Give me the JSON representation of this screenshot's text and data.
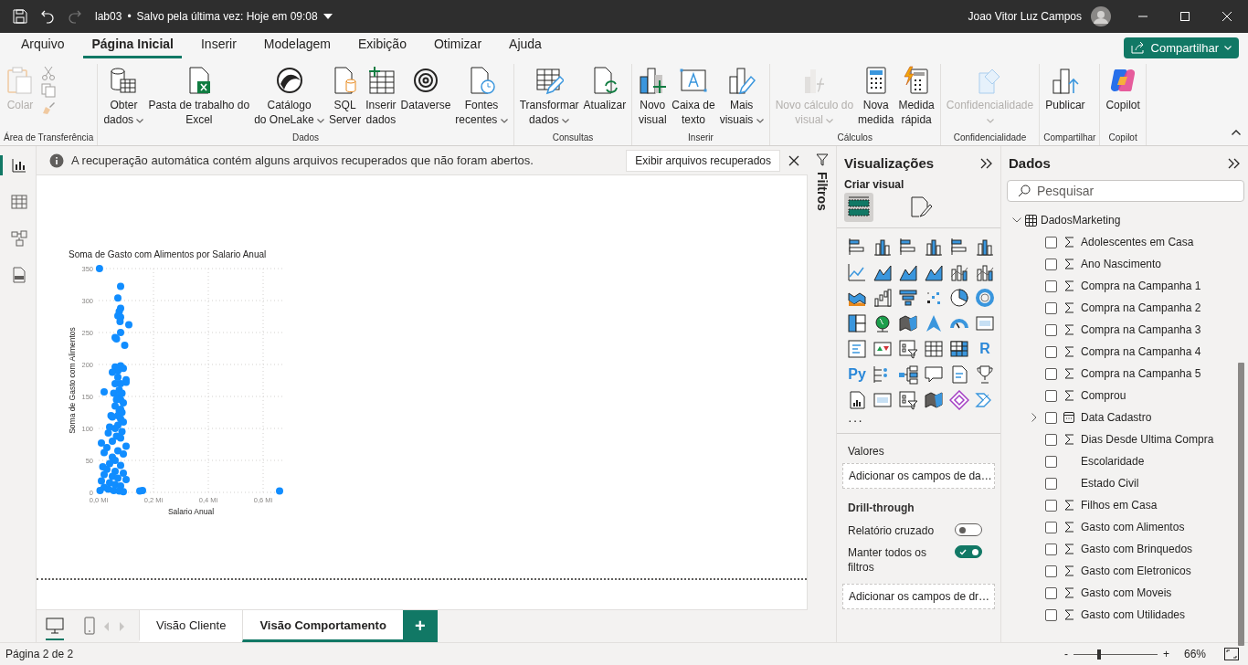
{
  "title_bar": {
    "file": "lab03",
    "separator": "•",
    "save_status": "Salvo pela última vez: Hoje em 09:08",
    "user": "Joao Vitor Luz Campos"
  },
  "menu_tabs": [
    {
      "label": "Arquivo",
      "selected": false
    },
    {
      "label": "Página Inicial",
      "selected": true
    },
    {
      "label": "Inserir",
      "selected": false
    },
    {
      "label": "Modelagem",
      "selected": false
    },
    {
      "label": "Exibição",
      "selected": false
    },
    {
      "label": "Otimizar",
      "selected": false
    },
    {
      "label": "Ajuda",
      "selected": false
    }
  ],
  "share_button": "Compartilhar",
  "ribbon": {
    "groups": [
      {
        "label": "Área de Transferência",
        "items": [
          {
            "lines": [
              "Colar"
            ],
            "dropdown": false,
            "disabled": true
          }
        ]
      },
      {
        "label": "Dados",
        "items": [
          {
            "lines": [
              "Obter",
              "dados"
            ],
            "dropdown": true,
            "disabled": false
          },
          {
            "lines": [
              "Pasta de trabalho do",
              "Excel"
            ],
            "dropdown": false,
            "disabled": false
          },
          {
            "lines": [
              "Catálogo",
              "do OneLake"
            ],
            "dropdown": true,
            "disabled": false
          },
          {
            "lines": [
              "SQL",
              "Server"
            ],
            "dropdown": false,
            "disabled": false
          },
          {
            "lines": [
              "Inserir",
              "dados"
            ],
            "dropdown": false,
            "disabled": false
          },
          {
            "lines": [
              "Dataverse"
            ],
            "dropdown": false,
            "disabled": false
          },
          {
            "lines": [
              "Fontes",
              "recentes"
            ],
            "dropdown": true,
            "disabled": false
          }
        ]
      },
      {
        "label": "Consultas",
        "items": [
          {
            "lines": [
              "Transformar",
              "dados"
            ],
            "dropdown": true,
            "disabled": false
          },
          {
            "lines": [
              "Atualizar"
            ],
            "dropdown": false,
            "disabled": false
          }
        ]
      },
      {
        "label": "Inserir",
        "items": [
          {
            "lines": [
              "Novo",
              "visual"
            ],
            "dropdown": false,
            "disabled": false
          },
          {
            "lines": [
              "Caixa de",
              "texto"
            ],
            "dropdown": false,
            "disabled": false
          },
          {
            "lines": [
              "Mais",
              "visuais"
            ],
            "dropdown": true,
            "disabled": false
          }
        ]
      },
      {
        "label": "Cálculos",
        "items": [
          {
            "lines": [
              "Novo cálculo do",
              "visual"
            ],
            "dropdown": true,
            "disabled": true
          },
          {
            "lines": [
              "Nova",
              "medida"
            ],
            "dropdown": false,
            "disabled": false
          },
          {
            "lines": [
              "Medida",
              "rápida"
            ],
            "dropdown": false,
            "disabled": false
          }
        ]
      },
      {
        "label": "Confidencialidade",
        "items": [
          {
            "lines": [
              "Confidencialidade"
            ],
            "dropdown": true,
            "disabled": true
          }
        ]
      },
      {
        "label": "Compartilhar",
        "items": [
          {
            "lines": [
              "Publicar"
            ],
            "dropdown": false,
            "disabled": false
          }
        ]
      },
      {
        "label": "Copilot",
        "items": [
          {
            "lines": [
              "Copilot"
            ],
            "dropdown": false,
            "disabled": false
          }
        ]
      }
    ]
  },
  "info_bar": {
    "message": "A recuperação automática contém alguns arquivos recuperados que não foram abertos.",
    "action": "Exibir arquivos recuperados"
  },
  "nav_views": [
    {
      "selected": true
    },
    {
      "selected": false
    },
    {
      "selected": false
    },
    {
      "selected": false
    }
  ],
  "chart": {
    "chart_data": {
      "type": "scatter",
      "title": "Soma de Gasto com Alimentos por Salario Anual",
      "xlabel": "Salario Anual",
      "ylabel": "Soma de Gasto com Alimentos",
      "grid": true,
      "xlim": [
        0,
        0.68
      ],
      "ylim": [
        0,
        350
      ],
      "xticks": [
        {
          "value": 0,
          "label": "0,0 Mi"
        },
        {
          "value": 0.2,
          "label": "0,2 Mi"
        },
        {
          "value": 0.4,
          "label": "0,4 Mi"
        },
        {
          "value": 0.6,
          "label": "0,6 Mi"
        }
      ],
      "yticks": [
        0,
        50,
        100,
        150,
        200,
        250,
        300,
        350
      ],
      "x": [
        0.08,
        0.07,
        0.08,
        0.075,
        0.07,
        0.08,
        0.078,
        0.11,
        0.08,
        0.06,
        0.065,
        0.095,
        0.08,
        0.06,
        0.09,
        0.07,
        0.05,
        0.1,
        0.1,
        0.06,
        0.02,
        0.055,
        0.07,
        0.08,
        0.09,
        0.06,
        0.075,
        0.045,
        0.05,
        0.08,
        0.09,
        0.07,
        0.04,
        0.06,
        0.085,
        0.035,
        0.065,
        0.08,
        0.05,
        0.01,
        0.1,
        0.03,
        0.07,
        0.02,
        0.09,
        0.05,
        0.06,
        0.04,
        0.08,
        0.015,
        0.03,
        0.06,
        0.09,
        0.02,
        0.05,
        0.07,
        0.1,
        0.01,
        0.04,
        0.06,
        0.08,
        0.02,
        0.035,
        0.055,
        0.075,
        0.09,
        0.005,
        0.15,
        0.16,
        0.66,
        0.003,
        0.07,
        0.08,
        0.075,
        0.085,
        0.065,
        0.08,
        0.07,
        0.085
      ],
      "series": [
        {
          "color": "#118dff",
          "values": [
            322,
            304,
            288,
            283,
            276,
            274,
            267,
            262,
            250,
            242,
            240,
            230,
            198,
            196,
            194,
            190,
            188,
            176,
            172,
            170,
            157,
            155,
            150,
            145,
            140,
            135,
            128,
            120,
            118,
            115,
            110,
            105,
            102,
            100,
            95,
            93,
            88,
            85,
            80,
            77,
            72,
            70,
            65,
            62,
            60,
            55,
            50,
            45,
            42,
            40,
            36,
            33,
            30,
            28,
            25,
            22,
            20,
            18,
            15,
            12,
            10,
            8,
            5,
            3,
            2,
            1,
            3,
            2,
            3,
            2,
            350,
            180,
            170,
            160,
            155,
            145,
            130,
            120,
            125
          ]
        }
      ]
    }
  },
  "layout_views": [
    {
      "selected": true
    },
    {
      "selected": false
    }
  ],
  "page_tabs": [
    {
      "label": "Visão Cliente",
      "selected": false
    },
    {
      "label": "Visão Comportamento",
      "selected": true
    }
  ],
  "add_page": "+",
  "filters_pane": {
    "title": "Filtros"
  },
  "visualizations": {
    "title": "Visualizações",
    "section": "Criar visual",
    "tabs": [
      {
        "selected": true
      },
      {
        "selected": false
      }
    ],
    "text_icons": [
      "R",
      "Py"
    ],
    "more": "···",
    "wells": [
      {
        "label": "Valores",
        "placeholder": "Adicionar os campos de da…"
      }
    ],
    "drill_through": {
      "title": "Drill-through",
      "toggles": [
        {
          "label": "Relatório cruzado",
          "on": false
        },
        {
          "label": "Manter todos os filtros",
          "on": true
        }
      ],
      "placeholder": "Adicionar os campos de dr…"
    }
  },
  "data": {
    "title": "Dados",
    "search": {
      "placeholder": "Pesquisar"
    },
    "tables": [
      {
        "name": "DadosMarketing",
        "expanded": true,
        "fields": [
          {
            "name": "Adolescentes em Casa",
            "kind": "measure",
            "checked": false
          },
          {
            "name": "Ano Nascimento",
            "kind": "measure",
            "checked": false
          },
          {
            "name": "Compra na Campanha 1",
            "kind": "measure",
            "checked": false
          },
          {
            "name": "Compra na Campanha 2",
            "kind": "measure",
            "checked": false
          },
          {
            "name": "Compra na Campanha 3",
            "kind": "measure",
            "checked": false
          },
          {
            "name": "Compra na Campanha 4",
            "kind": "measure",
            "checked": false
          },
          {
            "name": "Compra na Campanha 5",
            "kind": "measure",
            "checked": false
          },
          {
            "name": "Comprou",
            "kind": "measure",
            "checked": false
          },
          {
            "name": "Data Cadastro",
            "kind": "date",
            "checked": false
          },
          {
            "name": "Dias Desde Ultima Compra",
            "kind": "measure",
            "checked": false
          },
          {
            "name": "Escolaridade",
            "kind": "text",
            "checked": false
          },
          {
            "name": "Estado Civil",
            "kind": "text",
            "checked": false
          },
          {
            "name": "Filhos em Casa",
            "kind": "measure",
            "checked": false
          },
          {
            "name": "Gasto com Alimentos",
            "kind": "measure",
            "checked": false
          },
          {
            "name": "Gasto com Brinquedos",
            "kind": "measure",
            "checked": false
          },
          {
            "name": "Gasto com Eletronicos",
            "kind": "measure",
            "checked": false
          },
          {
            "name": "Gasto com Moveis",
            "kind": "measure",
            "checked": false
          },
          {
            "name": "Gasto com Utilidades",
            "kind": "measure",
            "checked": false
          }
        ]
      }
    ]
  },
  "status_bar": {
    "page": "Página 2 de 2",
    "zoom_out": "-",
    "zoom_in": "+",
    "zoom": {
      "level": 0.3
    },
    "zoom_label": "66%"
  }
}
